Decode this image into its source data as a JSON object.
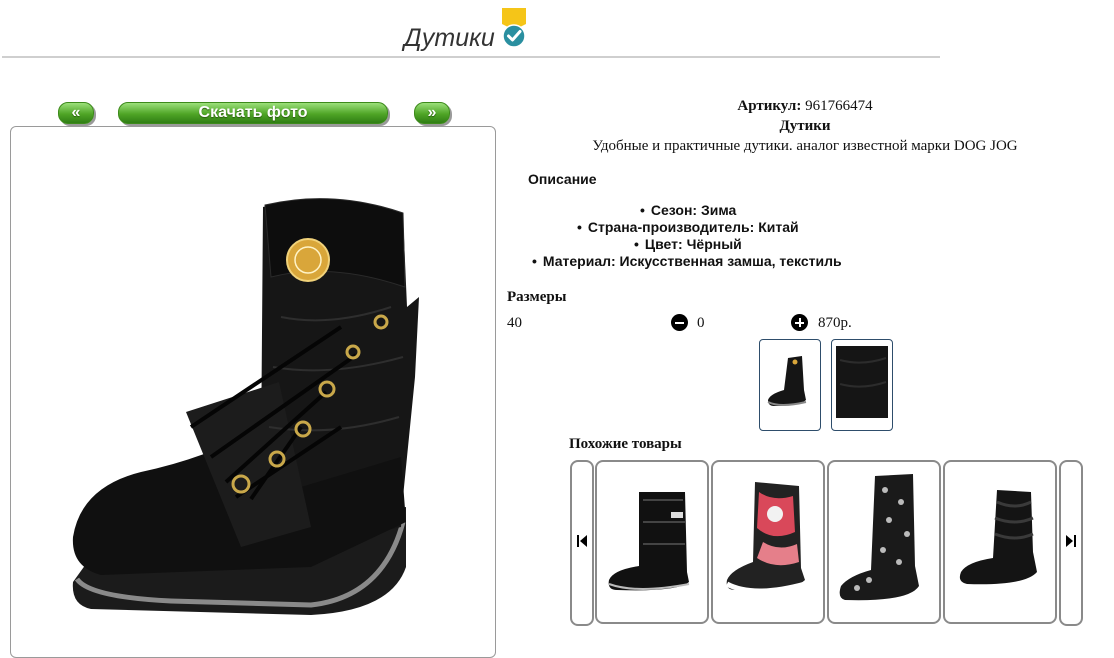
{
  "header": {
    "title": "Дутики",
    "badge_icon": "verified-check-icon"
  },
  "gallery": {
    "prev_label": "«",
    "download_label": "Скачать фото",
    "next_label": "»"
  },
  "product": {
    "sku_label": "Артикул:",
    "sku_value": "961766474",
    "name": "Дутики",
    "short_description": "Удобные и практичные дутики. аналог известной марки DOG JOG",
    "description_heading": "Описание",
    "features": [
      "Сезон: Зима",
      "Страна-производитель: Китай",
      "Цвет: Чёрный",
      "Материал: Искусственная замша, текстиль"
    ]
  },
  "sizes": {
    "heading": "Размеры",
    "rows": [
      {
        "size": "40",
        "quantity": "0",
        "price": "870р."
      }
    ]
  },
  "similar": {
    "heading": "Похожие товары"
  },
  "colors": {
    "accent_green": "#4fa526",
    "badge_yellow": "#f5c518",
    "badge_teal": "#2a8fa0",
    "thumb_border": "#2e4d6b"
  }
}
